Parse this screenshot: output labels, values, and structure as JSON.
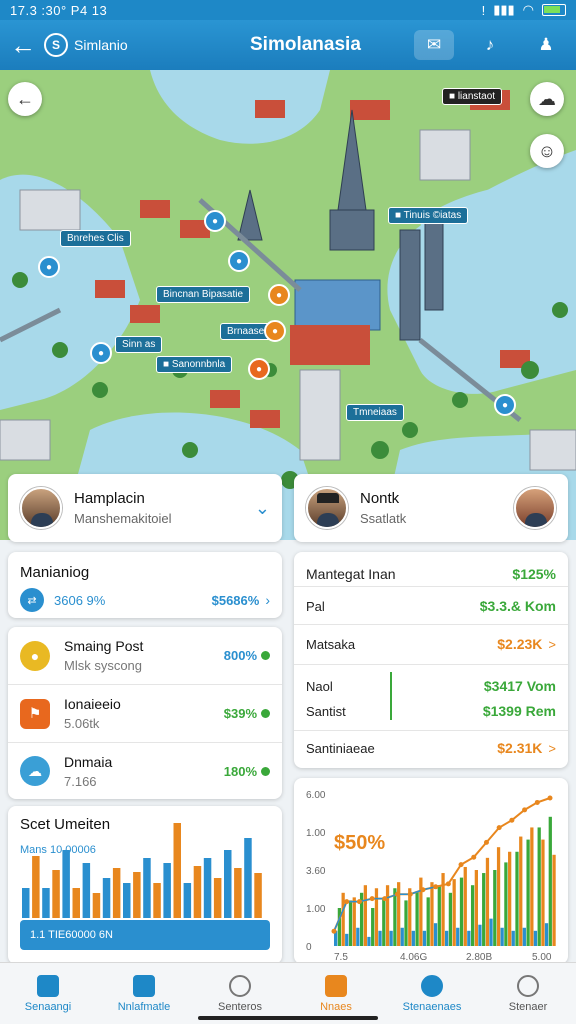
{
  "status": {
    "time": "17.3 :30° P4 13"
  },
  "appbar": {
    "brand": "Simlanio",
    "title": "Simolanasia"
  },
  "map": {
    "labels": [
      {
        "text": "■ lianstaot"
      },
      {
        "text": "■ Tinuis ©iatas"
      },
      {
        "text": "Bnrehes Clis"
      },
      {
        "text": "Bincnan Bipasatie"
      },
      {
        "text": "Brnaase"
      },
      {
        "text": "Sinn as"
      },
      {
        "text": "■ Sanonnbnla"
      },
      {
        "text": "Tmneiaas"
      }
    ]
  },
  "profile_left": {
    "name": "Hamplacin",
    "subtitle": "Manshemakitoiel"
  },
  "profile_right": {
    "name": "Nontk",
    "subtitle": "Ssatlatk"
  },
  "managing": {
    "title": "Manianiog",
    "left": "3606 9%",
    "right": "$5686%"
  },
  "list": [
    {
      "title": "Smaing Post",
      "subtitle": "Mlsk syscong",
      "value": "800%",
      "icon_color": "#e9b923",
      "value_class": "blue"
    },
    {
      "title": "Ionaieeio",
      "subtitle": "5.06tk",
      "value": "$39%",
      "icon_color": "#e8681e",
      "value_class": "green"
    },
    {
      "title": "Dnmaia",
      "subtitle": "7.166",
      "value": "180%",
      "icon_color": "#3a9fd6",
      "value_class": "green"
    }
  ],
  "stats": {
    "header_label": "Mantegat Inan",
    "header_value": "$125%",
    "rows": [
      {
        "label": "Pal",
        "value": "$3.3.& Kom",
        "cls": "green"
      },
      {
        "label": "Matsaka",
        "value": "$2.23K",
        "cls": "orange",
        "chev": ">"
      },
      {
        "label": "Naol",
        "value": "$3417 Vom",
        "cls": "green"
      },
      {
        "label": "Santist",
        "value": "$1399 Rem",
        "cls": "green"
      }
    ],
    "footer_label": "Santiniaeae",
    "footer_value": "$2.31K",
    "footer_chev": ">"
  },
  "mini_chart": {
    "title": "Scet Umeiten",
    "legend": "Mans 10.00006",
    "footer": "1.1 TIE60000 6N",
    "bar_colors": [
      "#2a8fcf",
      "#e8871e"
    ],
    "values": [
      0.3,
      0.62,
      0.3,
      0.48,
      0.68,
      0.3,
      0.55,
      0.25,
      0.4,
      0.5,
      0.35,
      0.46,
      0.6,
      0.35,
      0.55,
      0.95,
      0.35,
      0.52,
      0.6,
      0.4,
      0.68,
      0.5,
      0.8,
      0.45
    ]
  },
  "chart_data": {
    "type": "bar",
    "title": "",
    "y_ticks": [
      "6.00",
      "1.00",
      "3.60",
      "1.00",
      "0"
    ],
    "x_ticks": [
      "7.5",
      "4.06G",
      "2.80B",
      "5.00"
    ],
    "annotation": "$50%",
    "series": [
      {
        "color": "#2a8fcf",
        "values": [
          0.1,
          0.08,
          0.12,
          0.06,
          0.1,
          0.1,
          0.12,
          0.1,
          0.1,
          0.15,
          0.1,
          0.12,
          0.1,
          0.14,
          0.18,
          0.12,
          0.1,
          0.12,
          0.1,
          0.15
        ]
      },
      {
        "color": "#3aa83a",
        "values": [
          0.25,
          0.3,
          0.35,
          0.25,
          0.32,
          0.38,
          0.3,
          0.36,
          0.32,
          0.4,
          0.35,
          0.45,
          0.4,
          0.48,
          0.5,
          0.55,
          0.62,
          0.7,
          0.78,
          0.85
        ]
      },
      {
        "color": "#e8871e",
        "values": [
          0.35,
          0.32,
          0.4,
          0.38,
          0.4,
          0.42,
          0.38,
          0.45,
          0.42,
          0.48,
          0.44,
          0.52,
          0.5,
          0.58,
          0.65,
          0.62,
          0.72,
          0.78,
          0.7,
          0.6
        ]
      }
    ],
    "line": [
      0.1,
      0.3,
      0.3,
      0.32,
      0.32,
      0.35,
      0.35,
      0.38,
      0.4,
      0.42,
      0.55,
      0.6,
      0.7,
      0.8,
      0.85,
      0.92,
      0.97,
      1.0
    ],
    "line_color": "#e8871e"
  },
  "nav": [
    {
      "label": "Senaangi",
      "cls": "active-blue"
    },
    {
      "label": "Nnlafmatle",
      "cls": "active-blue"
    },
    {
      "label": "Senteros",
      "cls": ""
    },
    {
      "label": "Nnaes",
      "cls": "active-orange"
    },
    {
      "label": "Stenaenaes",
      "cls": "active-blue"
    },
    {
      "label": "Stenaer",
      "cls": ""
    }
  ]
}
